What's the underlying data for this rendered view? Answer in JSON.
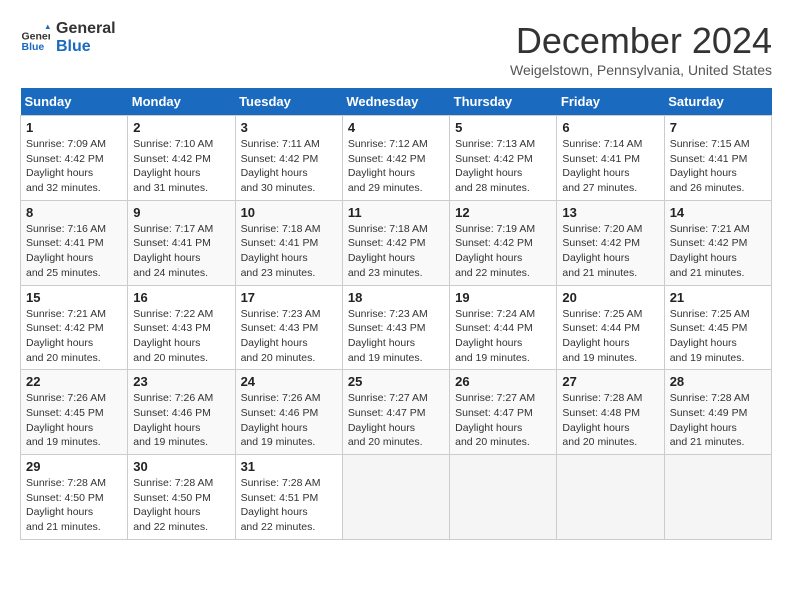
{
  "header": {
    "logo_line1": "General",
    "logo_line2": "Blue",
    "month": "December 2024",
    "location": "Weigelstown, Pennsylvania, United States"
  },
  "columns": [
    "Sunday",
    "Monday",
    "Tuesday",
    "Wednesday",
    "Thursday",
    "Friday",
    "Saturday"
  ],
  "weeks": [
    [
      {
        "day": 1,
        "sunrise": "7:09 AM",
        "sunset": "4:42 PM",
        "daylight": "9 hours and 32 minutes."
      },
      {
        "day": 2,
        "sunrise": "7:10 AM",
        "sunset": "4:42 PM",
        "daylight": "9 hours and 31 minutes."
      },
      {
        "day": 3,
        "sunrise": "7:11 AM",
        "sunset": "4:42 PM",
        "daylight": "9 hours and 30 minutes."
      },
      {
        "day": 4,
        "sunrise": "7:12 AM",
        "sunset": "4:42 PM",
        "daylight": "9 hours and 29 minutes."
      },
      {
        "day": 5,
        "sunrise": "7:13 AM",
        "sunset": "4:42 PM",
        "daylight": "9 hours and 28 minutes."
      },
      {
        "day": 6,
        "sunrise": "7:14 AM",
        "sunset": "4:41 PM",
        "daylight": "9 hours and 27 minutes."
      },
      {
        "day": 7,
        "sunrise": "7:15 AM",
        "sunset": "4:41 PM",
        "daylight": "9 hours and 26 minutes."
      }
    ],
    [
      {
        "day": 8,
        "sunrise": "7:16 AM",
        "sunset": "4:41 PM",
        "daylight": "9 hours and 25 minutes."
      },
      {
        "day": 9,
        "sunrise": "7:17 AM",
        "sunset": "4:41 PM",
        "daylight": "9 hours and 24 minutes."
      },
      {
        "day": 10,
        "sunrise": "7:18 AM",
        "sunset": "4:41 PM",
        "daylight": "9 hours and 23 minutes."
      },
      {
        "day": 11,
        "sunrise": "7:18 AM",
        "sunset": "4:42 PM",
        "daylight": "9 hours and 23 minutes."
      },
      {
        "day": 12,
        "sunrise": "7:19 AM",
        "sunset": "4:42 PM",
        "daylight": "9 hours and 22 minutes."
      },
      {
        "day": 13,
        "sunrise": "7:20 AM",
        "sunset": "4:42 PM",
        "daylight": "9 hours and 21 minutes."
      },
      {
        "day": 14,
        "sunrise": "7:21 AM",
        "sunset": "4:42 PM",
        "daylight": "9 hours and 21 minutes."
      }
    ],
    [
      {
        "day": 15,
        "sunrise": "7:21 AM",
        "sunset": "4:42 PM",
        "daylight": "9 hours and 20 minutes."
      },
      {
        "day": 16,
        "sunrise": "7:22 AM",
        "sunset": "4:43 PM",
        "daylight": "9 hours and 20 minutes."
      },
      {
        "day": 17,
        "sunrise": "7:23 AM",
        "sunset": "4:43 PM",
        "daylight": "9 hours and 20 minutes."
      },
      {
        "day": 18,
        "sunrise": "7:23 AM",
        "sunset": "4:43 PM",
        "daylight": "9 hours and 19 minutes."
      },
      {
        "day": 19,
        "sunrise": "7:24 AM",
        "sunset": "4:44 PM",
        "daylight": "9 hours and 19 minutes."
      },
      {
        "day": 20,
        "sunrise": "7:25 AM",
        "sunset": "4:44 PM",
        "daylight": "9 hours and 19 minutes."
      },
      {
        "day": 21,
        "sunrise": "7:25 AM",
        "sunset": "4:45 PM",
        "daylight": "9 hours and 19 minutes."
      }
    ],
    [
      {
        "day": 22,
        "sunrise": "7:26 AM",
        "sunset": "4:45 PM",
        "daylight": "9 hours and 19 minutes."
      },
      {
        "day": 23,
        "sunrise": "7:26 AM",
        "sunset": "4:46 PM",
        "daylight": "9 hours and 19 minutes."
      },
      {
        "day": 24,
        "sunrise": "7:26 AM",
        "sunset": "4:46 PM",
        "daylight": "9 hours and 19 minutes."
      },
      {
        "day": 25,
        "sunrise": "7:27 AM",
        "sunset": "4:47 PM",
        "daylight": "9 hours and 20 minutes."
      },
      {
        "day": 26,
        "sunrise": "7:27 AM",
        "sunset": "4:47 PM",
        "daylight": "9 hours and 20 minutes."
      },
      {
        "day": 27,
        "sunrise": "7:28 AM",
        "sunset": "4:48 PM",
        "daylight": "9 hours and 20 minutes."
      },
      {
        "day": 28,
        "sunrise": "7:28 AM",
        "sunset": "4:49 PM",
        "daylight": "9 hours and 21 minutes."
      }
    ],
    [
      {
        "day": 29,
        "sunrise": "7:28 AM",
        "sunset": "4:50 PM",
        "daylight": "9 hours and 21 minutes."
      },
      {
        "day": 30,
        "sunrise": "7:28 AM",
        "sunset": "4:50 PM",
        "daylight": "9 hours and 22 minutes."
      },
      {
        "day": 31,
        "sunrise": "7:28 AM",
        "sunset": "4:51 PM",
        "daylight": "9 hours and 22 minutes."
      },
      null,
      null,
      null,
      null
    ]
  ]
}
